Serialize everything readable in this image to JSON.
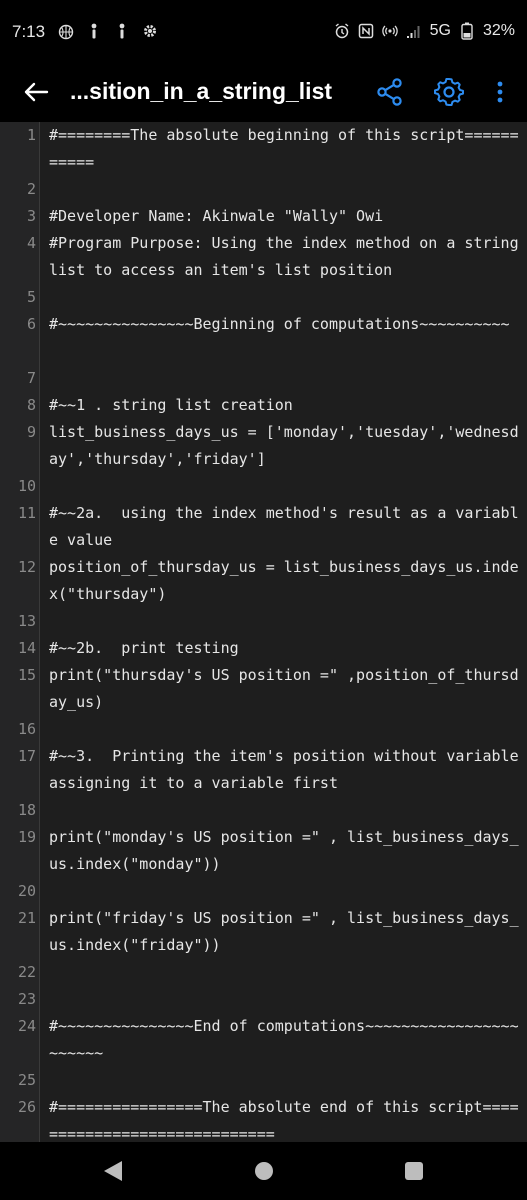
{
  "status_bar": {
    "time": "7:13",
    "network": "5G",
    "battery": "32%"
  },
  "app_bar": {
    "title": "...sition_in_a_string_list"
  },
  "colors": {
    "accent": "#2d8cf0",
    "editor_bg": "#1e1e1e",
    "gutter_bg": "#252526",
    "text": "#e6e6e6",
    "line_number": "#8a8a8a"
  },
  "code_lines": [
    {
      "n": "1",
      "text": "#========The absolute beginning of this script===========",
      "rows": 2
    },
    {
      "n": "2",
      "text": "",
      "rows": 1
    },
    {
      "n": "3",
      "text": "#Developer Name: Akinwale \"Wally\" Owi",
      "rows": 1
    },
    {
      "n": "4",
      "text": "#Program Purpose: Using the index method on a string list to access an item's list position",
      "rows": 2
    },
    {
      "n": "5",
      "text": "",
      "rows": 1
    },
    {
      "n": "6",
      "text": "#~~~~~~~~~~~~~~~Beginning of computations~~~~~~~~~~",
      "rows": 2
    },
    {
      "n": "7",
      "text": "",
      "rows": 1
    },
    {
      "n": "8",
      "text": "#~~1 . string list creation",
      "rows": 1
    },
    {
      "n": "9",
      "text": "list_business_days_us = ['monday','tuesday','wednesday','thursday','friday']",
      "rows": 2
    },
    {
      "n": "10",
      "text": "",
      "rows": 1
    },
    {
      "n": "11",
      "text": "#~~2a.  using the index method's result as a variable value",
      "rows": 2
    },
    {
      "n": "12",
      "text": "position_of_thursday_us = list_business_days_us.index(\"thursday\")",
      "rows": 2
    },
    {
      "n": "13",
      "text": "",
      "rows": 1
    },
    {
      "n": "14",
      "text": "#~~2b.  print testing",
      "rows": 1
    },
    {
      "n": "15",
      "text": "print(\"thursday's US position =\" ,position_of_thursday_us)",
      "rows": 2
    },
    {
      "n": "16",
      "text": "",
      "rows": 1
    },
    {
      "n": "17",
      "text": "#~~3.  Printing the item's position without variable assigning it to a variable first",
      "rows": 2
    },
    {
      "n": "18",
      "text": "",
      "rows": 1
    },
    {
      "n": "19",
      "text": "print(\"monday's US position =\" , list_business_days_us.index(\"monday\"))",
      "rows": 2
    },
    {
      "n": "20",
      "text": "",
      "rows": 1
    },
    {
      "n": "21",
      "text": "print(\"friday's US position =\" , list_business_days_us.index(\"friday\"))",
      "rows": 2
    },
    {
      "n": "22",
      "text": "",
      "rows": 1
    },
    {
      "n": "23",
      "text": "",
      "rows": 1
    },
    {
      "n": "24",
      "text": "#~~~~~~~~~~~~~~~End of computations~~~~~~~~~~~~~~~~~~~~~~~",
      "rows": 2
    },
    {
      "n": "25",
      "text": "",
      "rows": 1
    },
    {
      "n": "26",
      "text": "#================The absolute end of this script=============================",
      "rows": 2
    }
  ]
}
